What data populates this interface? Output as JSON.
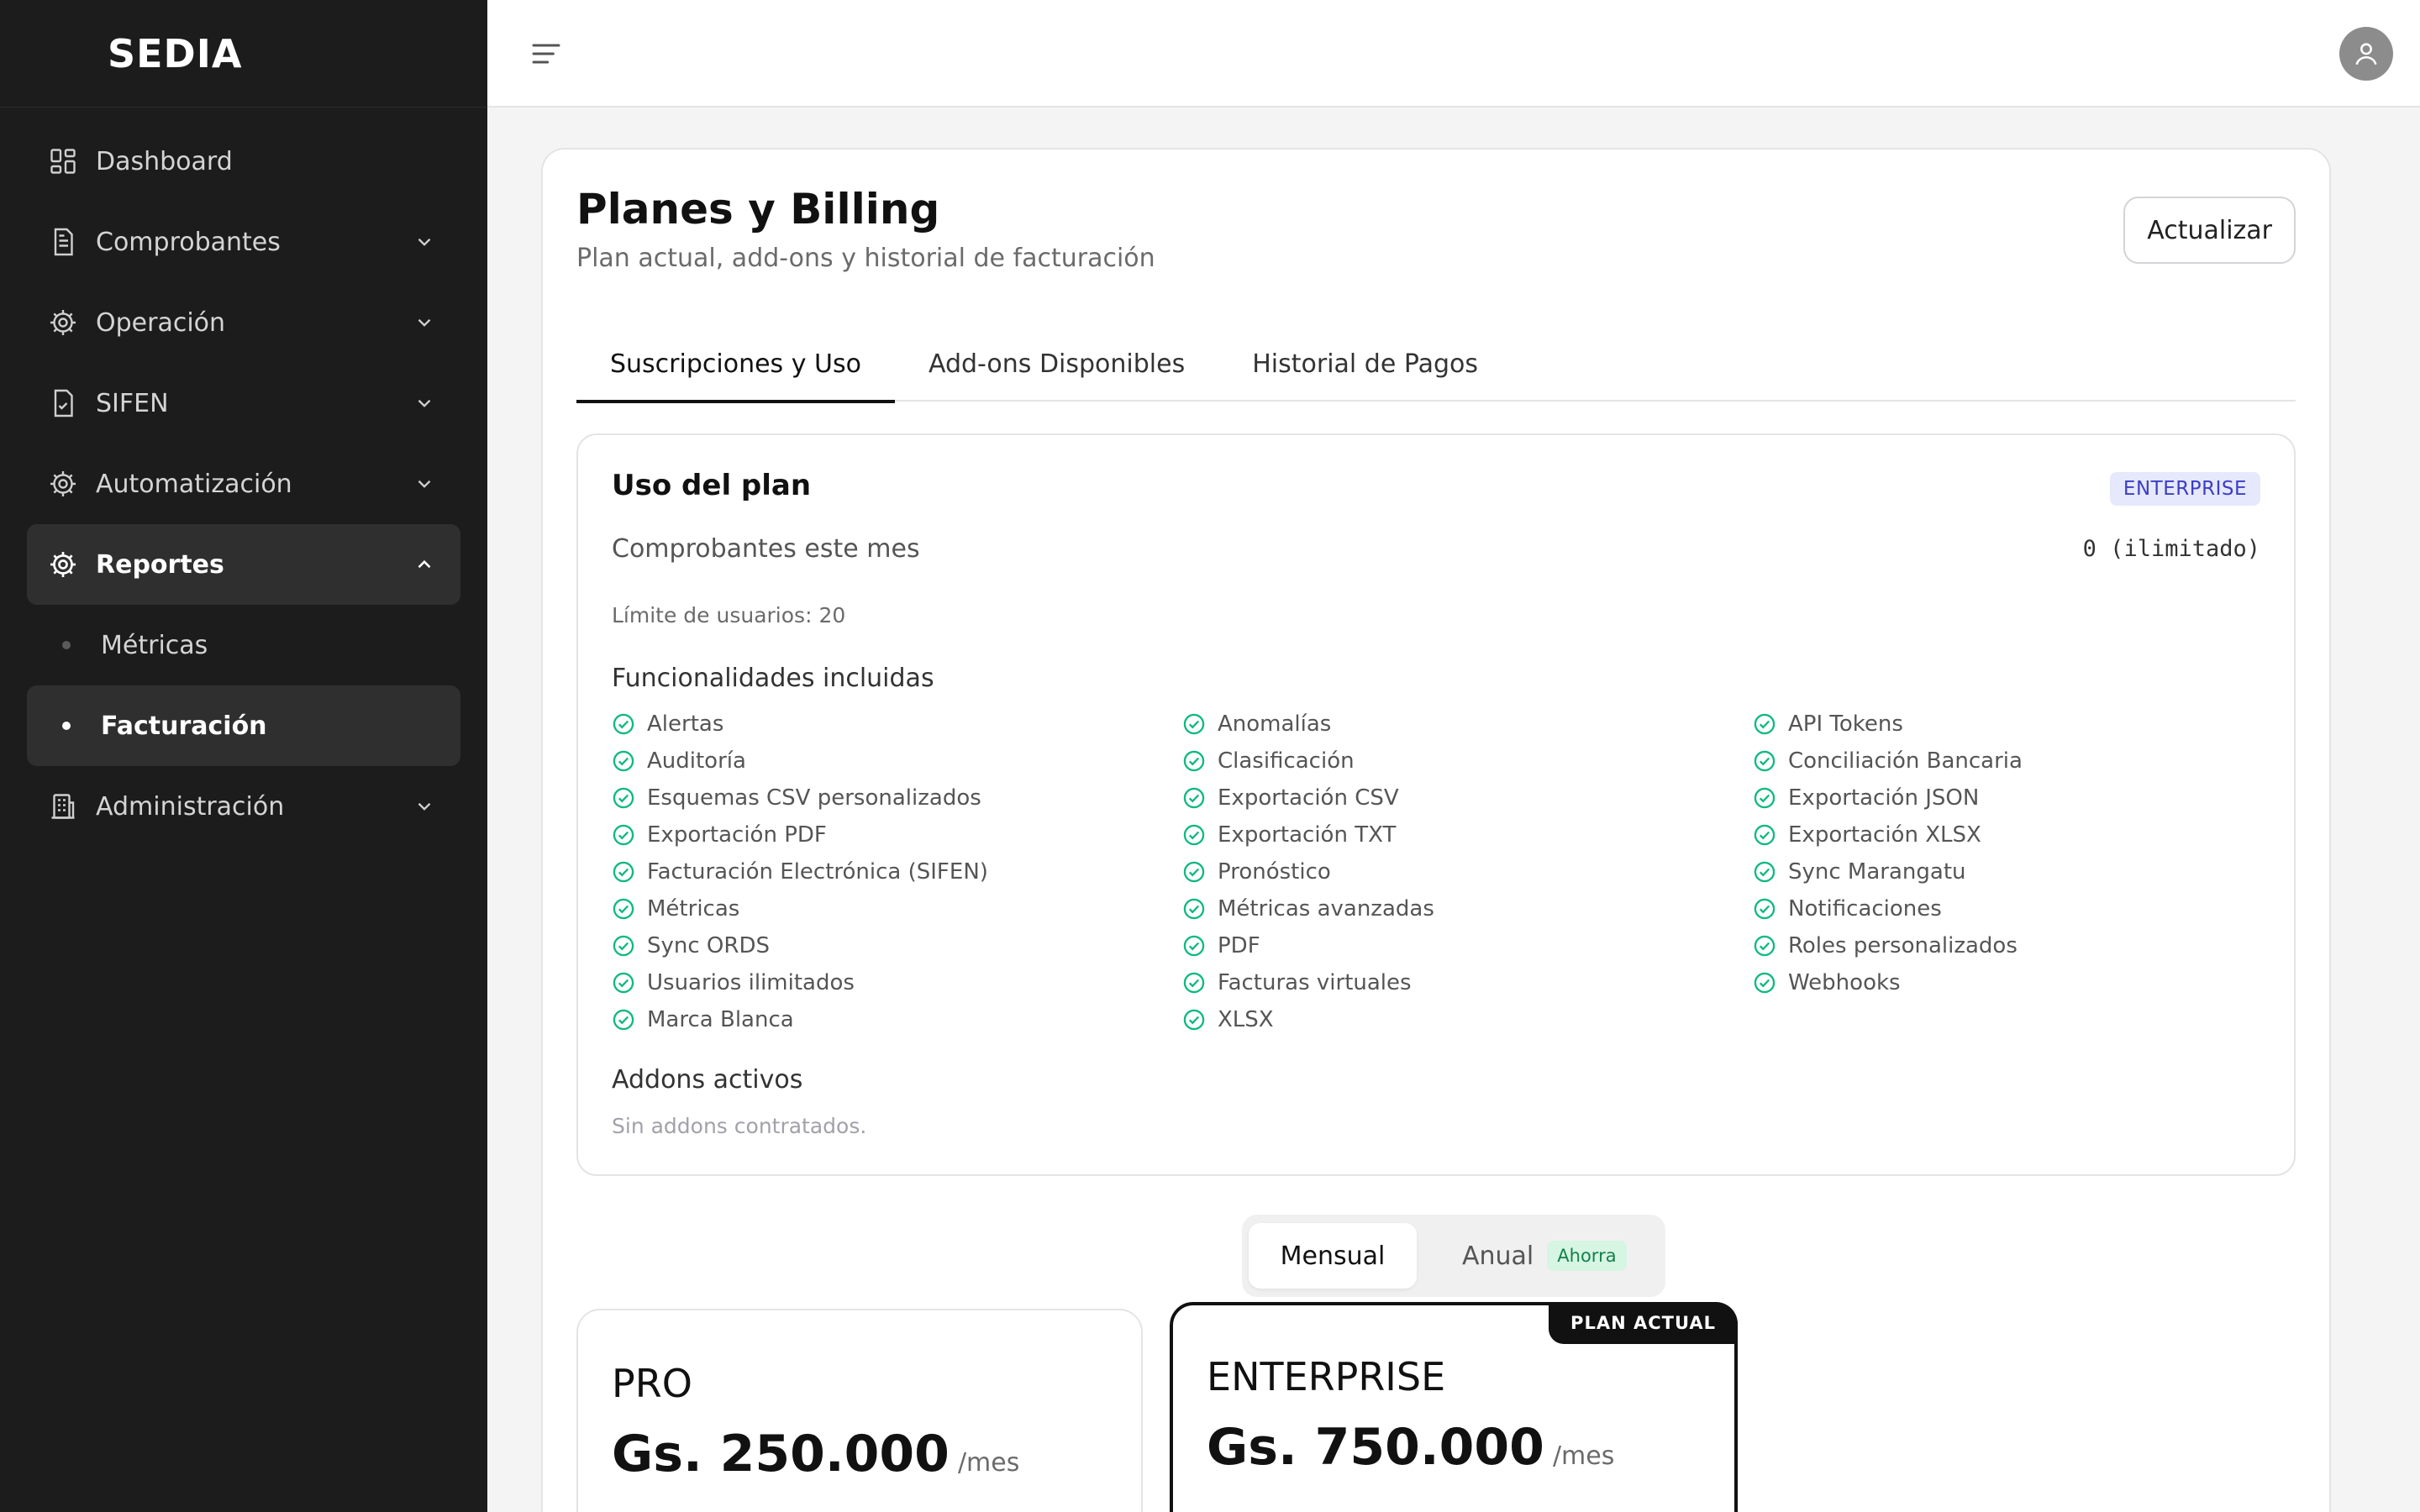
{
  "brand": "SEDIA",
  "sidebar": {
    "items": [
      {
        "label": "Dashboard",
        "icon": "dashboard-icon"
      },
      {
        "label": "Comprobantes",
        "icon": "document-icon"
      },
      {
        "label": "Operación",
        "icon": "gear-icon"
      },
      {
        "label": "SIFEN",
        "icon": "file-check-icon"
      },
      {
        "label": "Automatización",
        "icon": "gear-icon"
      },
      {
        "label": "Reportes",
        "icon": "gear-icon"
      },
      {
        "label": "Administración",
        "icon": "building-icon"
      }
    ],
    "sub_items": [
      {
        "label": "Métricas"
      },
      {
        "label": "Facturación"
      }
    ]
  },
  "page": {
    "title": "Planes y Billing",
    "subtitle": "Plan actual, add-ons y historial de facturación",
    "refresh_label": "Actualizar"
  },
  "tabs": [
    {
      "label": "Suscripciones y Uso"
    },
    {
      "label": "Add-ons Disponibles"
    },
    {
      "label": "Historial de Pagos"
    }
  ],
  "usage": {
    "title": "Uso del plan",
    "plan_badge": "ENTERPRISE",
    "comprobantes_label": "Comprobantes este mes",
    "comprobantes_value": "0 (ilimitado)",
    "user_limit": "Límite de usuarios: 20",
    "features_title": "Funcionalidades incluidas",
    "features": [
      "Alertas",
      "Anomalías",
      "API Tokens",
      "Auditoría",
      "Clasificación",
      "Conciliación Bancaria",
      "Esquemas CSV personalizados",
      "Exportación CSV",
      "Exportación JSON",
      "Exportación PDF",
      "Exportación TXT",
      "Exportación XLSX",
      "Facturación Electrónica (SIFEN)",
      "Pronóstico",
      "Sync Marangatu",
      "Métricas",
      "Métricas avanzadas",
      "Notificaciones",
      "Sync ORDS",
      "PDF",
      "Roles personalizados",
      "Usuarios ilimitados",
      "Facturas virtuales",
      "Webhooks",
      "Marca Blanca",
      "XLSX"
    ],
    "addons_title": "Addons activos",
    "addons_empty": "Sin addons contratados."
  },
  "billing_toggle": {
    "monthly": "Mensual",
    "annual": "Anual",
    "save_badge": "Ahorra"
  },
  "plans": [
    {
      "name": "PRO",
      "price": "Gs. 250.000",
      "period": "/mes"
    },
    {
      "name": "ENTERPRISE",
      "price": "Gs. 750.000",
      "period": "/mes",
      "current_label": "PLAN ACTUAL"
    }
  ],
  "colors": {
    "sidebar_bg": "#1c1c1c",
    "accent_badge_bg": "#e6e8fb",
    "accent_badge_fg": "#3b3fc4",
    "check_green": "#10b981",
    "save_badge_bg": "#d6f5e3"
  }
}
